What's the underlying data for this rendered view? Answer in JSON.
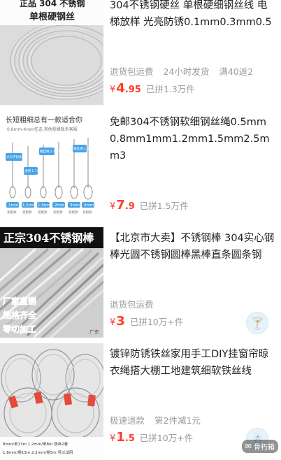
{
  "products": [
    {
      "title": "304不锈钢硬丝 单根硬细钢丝线 电梯放样 光亮防锈0.1mm0.3mm0.5",
      "tags": [
        "退货包运费",
        "24小时发货",
        "满40返2"
      ],
      "currency": "¥",
      "price_int": "4",
      "price_dec": ".95",
      "sold": "已拼1.3万件",
      "image": {
        "overlay_line1": "正品 304 不锈钢",
        "overlay_line2": "单根硬钢丝"
      }
    },
    {
      "title": "免邮304不锈钢软细钢丝绳0.5mm 0.8mm1mm1.2mm1.5mm2.5mm3",
      "tags": [],
      "currency": "¥",
      "price_int": "7",
      "price_dec": ".9",
      "sold": "已拼1.5万件",
      "image": {
        "heading": "长短粗细总有一款适合你",
        "subheading": "0.8mm-4mm任选 其他规格联系客服",
        "sizes": [
          "1mm",
          "1.2mm",
          "1.5mm",
          "2mm",
          "3mm",
          "4mm"
        ],
        "tails": [
          "宽粗款",
          "宽粗款",
          "宽粗款",
          "宽粗款",
          "宽粗款",
          "宽粗款"
        ],
        "callouts": [
          "大头环扣式 1.1mm",
          "透明 1.7mm",
          "钢丝绳 2.1mm",
          "钢丝绳 4.5mm"
        ]
      }
    },
    {
      "title": "【北京市大卖】不锈钢棒 304实心钢棒光圆不锈钢圆棒黑棒直条圆条钢",
      "tags": [
        "退货包运费"
      ],
      "currency": "¥",
      "price_int": "3",
      "price_dec": "",
      "sold": "已拼10万+件",
      "image": {
        "banner": "正宗304不锈钢棒",
        "side_text": [
          "厂家直销",
          "规格齐全",
          "零切加工"
        ],
        "corner": "广东"
      }
    },
    {
      "title": "镀锌防锈铁丝家用手工DIY挂窗帘晾衣绳搭大棚工地建筑细软铁丝线",
      "tags": [
        "极速退款",
        "第2件减1元"
      ],
      "currency": "¥",
      "price_int": "1",
      "price_dec": ".5",
      "sold": "已拼10万+件",
      "image": {
        "bottom_text": [
          "8mm/单13m 1.2mm/单8m 铁丝2卷",
          "1.8mm/卷13m 2.2mm/卷5m 可以试用"
        ]
      }
    }
  ],
  "watermark": {
    "label": "骨朽箱"
  },
  "colors": {
    "price": "#ff3c2a",
    "meta": "#9a9a9a",
    "title": "#222222"
  }
}
